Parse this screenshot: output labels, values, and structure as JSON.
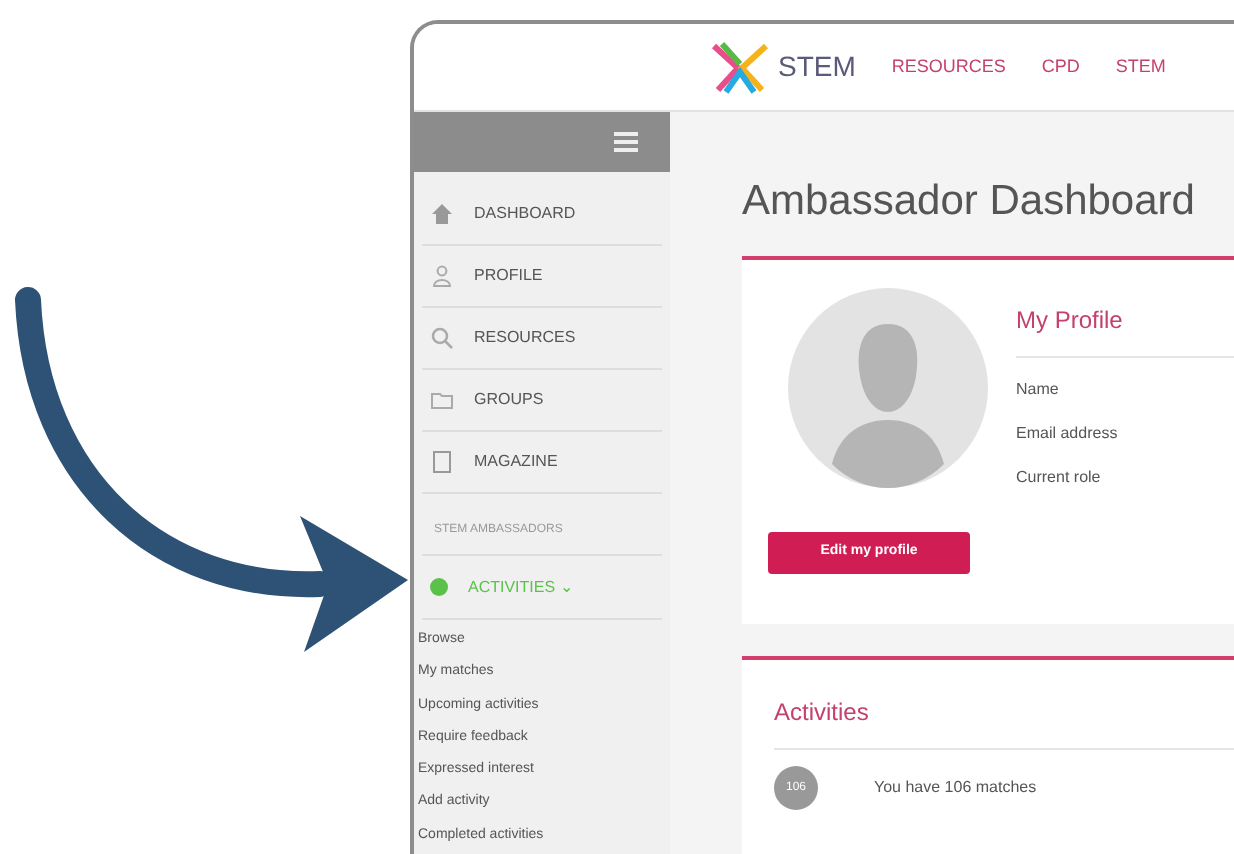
{
  "top_nav": {
    "logo": "STEM",
    "links": [
      "RESOURCES",
      "CPD",
      "STEM"
    ]
  },
  "sidebar": {
    "items": [
      {
        "kind": "link",
        "label": "DASHBOARD",
        "selected": false
      },
      {
        "kind": "link",
        "label": "PROFILE",
        "selected": false
      },
      {
        "kind": "link",
        "label": "RESOURCES",
        "selected": false
      },
      {
        "kind": "link",
        "label": "GROUPS",
        "selected": false
      },
      {
        "kind": "link",
        "label": "MAGAZINE",
        "selected": false
      },
      {
        "kind": "section",
        "label": "STEM AMBASSADORS"
      },
      {
        "kind": "link",
        "label": "ACTIVITIES",
        "caret": "⌄",
        "selected": true,
        "children": [
          "Browse",
          "My matches",
          "Upcoming activities",
          "Require feedback",
          "Expressed interest",
          "Add activity",
          "Completed activities"
        ]
      }
    ]
  },
  "page_title": "Ambassador Dashboard",
  "profile_card": {
    "heading": "My Profile",
    "fields": [
      "Name",
      "Email address",
      "Current role"
    ],
    "button": "Edit my profile"
  },
  "activities_card": {
    "heading": "Activities",
    "rows": [
      {
        "badge": "106",
        "text": "You have 106 matches"
      }
    ]
  }
}
